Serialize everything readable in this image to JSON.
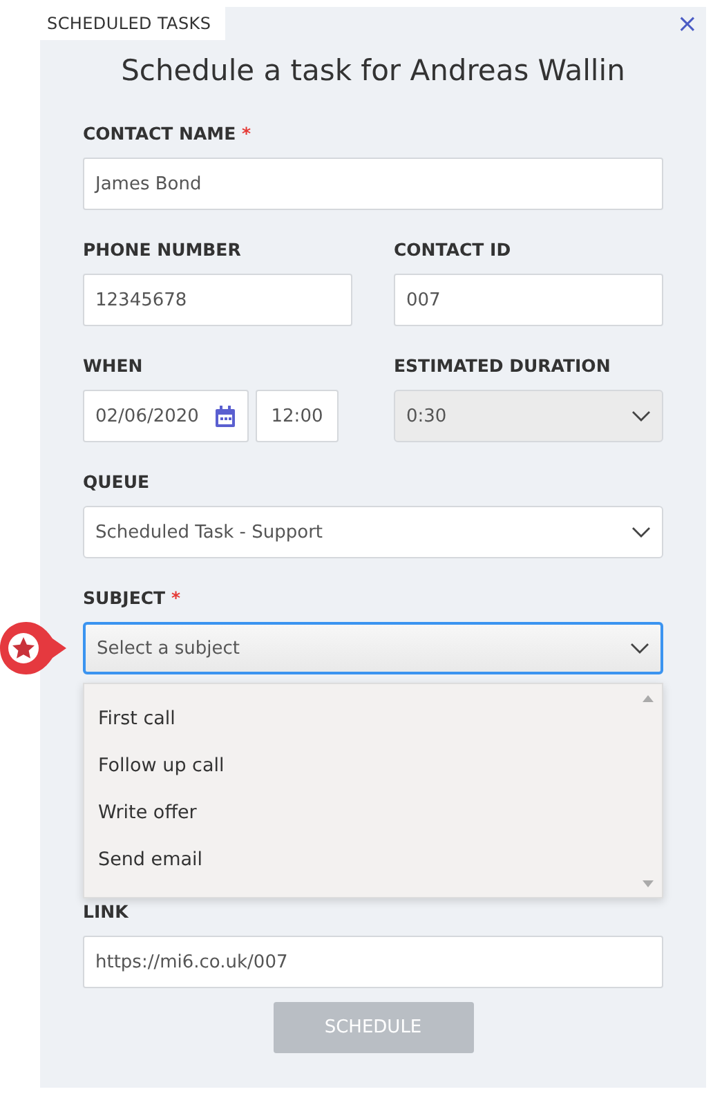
{
  "tab": {
    "label": "SCHEDULED TASKS",
    "selected": true
  },
  "close": "×",
  "title": "Schedule a task for Andreas Wallin",
  "rows": [
    {
      "fields": [
        {
          "kind": "text",
          "label": "CONTACT NAME",
          "required_mark": "*",
          "value": "James Bond"
        }
      ]
    },
    {
      "fields": [
        {
          "kind": "text",
          "label": "PHONE NUMBER",
          "value": "12345678"
        },
        {
          "kind": "text",
          "label": "CONTACT ID",
          "value": "007"
        }
      ]
    },
    {
      "fields": [
        {
          "kind": "datetime",
          "label": "WHEN",
          "date": "02/06/2020",
          "time": "12:00"
        },
        {
          "kind": "select",
          "label": "ESTIMATED DURATION",
          "value": "0:30",
          "disabled": true,
          "focused": false
        }
      ]
    },
    {
      "fields": [
        {
          "kind": "select",
          "label": "QUEUE",
          "value": "Scheduled Task - Support",
          "disabled": false,
          "focused": false
        }
      ]
    },
    {
      "fields": [
        {
          "kind": "select",
          "label": "SUBJECT",
          "required_mark": "*",
          "placeholder": "Select a subject",
          "disabled": false,
          "focused": true,
          "options": [
            {
              "label": "First call",
              "selected": false
            },
            {
              "label": "Follow up call",
              "selected": false
            },
            {
              "label": "Write offer",
              "selected": false
            },
            {
              "label": "Send email",
              "selected": false
            }
          ]
        }
      ]
    },
    {
      "fields": [
        {
          "kind": "text",
          "label": "LINK",
          "value": "https://mi6.co.uk/007"
        }
      ]
    }
  ],
  "button": {
    "label": "SCHEDULE",
    "disabled": true
  }
}
